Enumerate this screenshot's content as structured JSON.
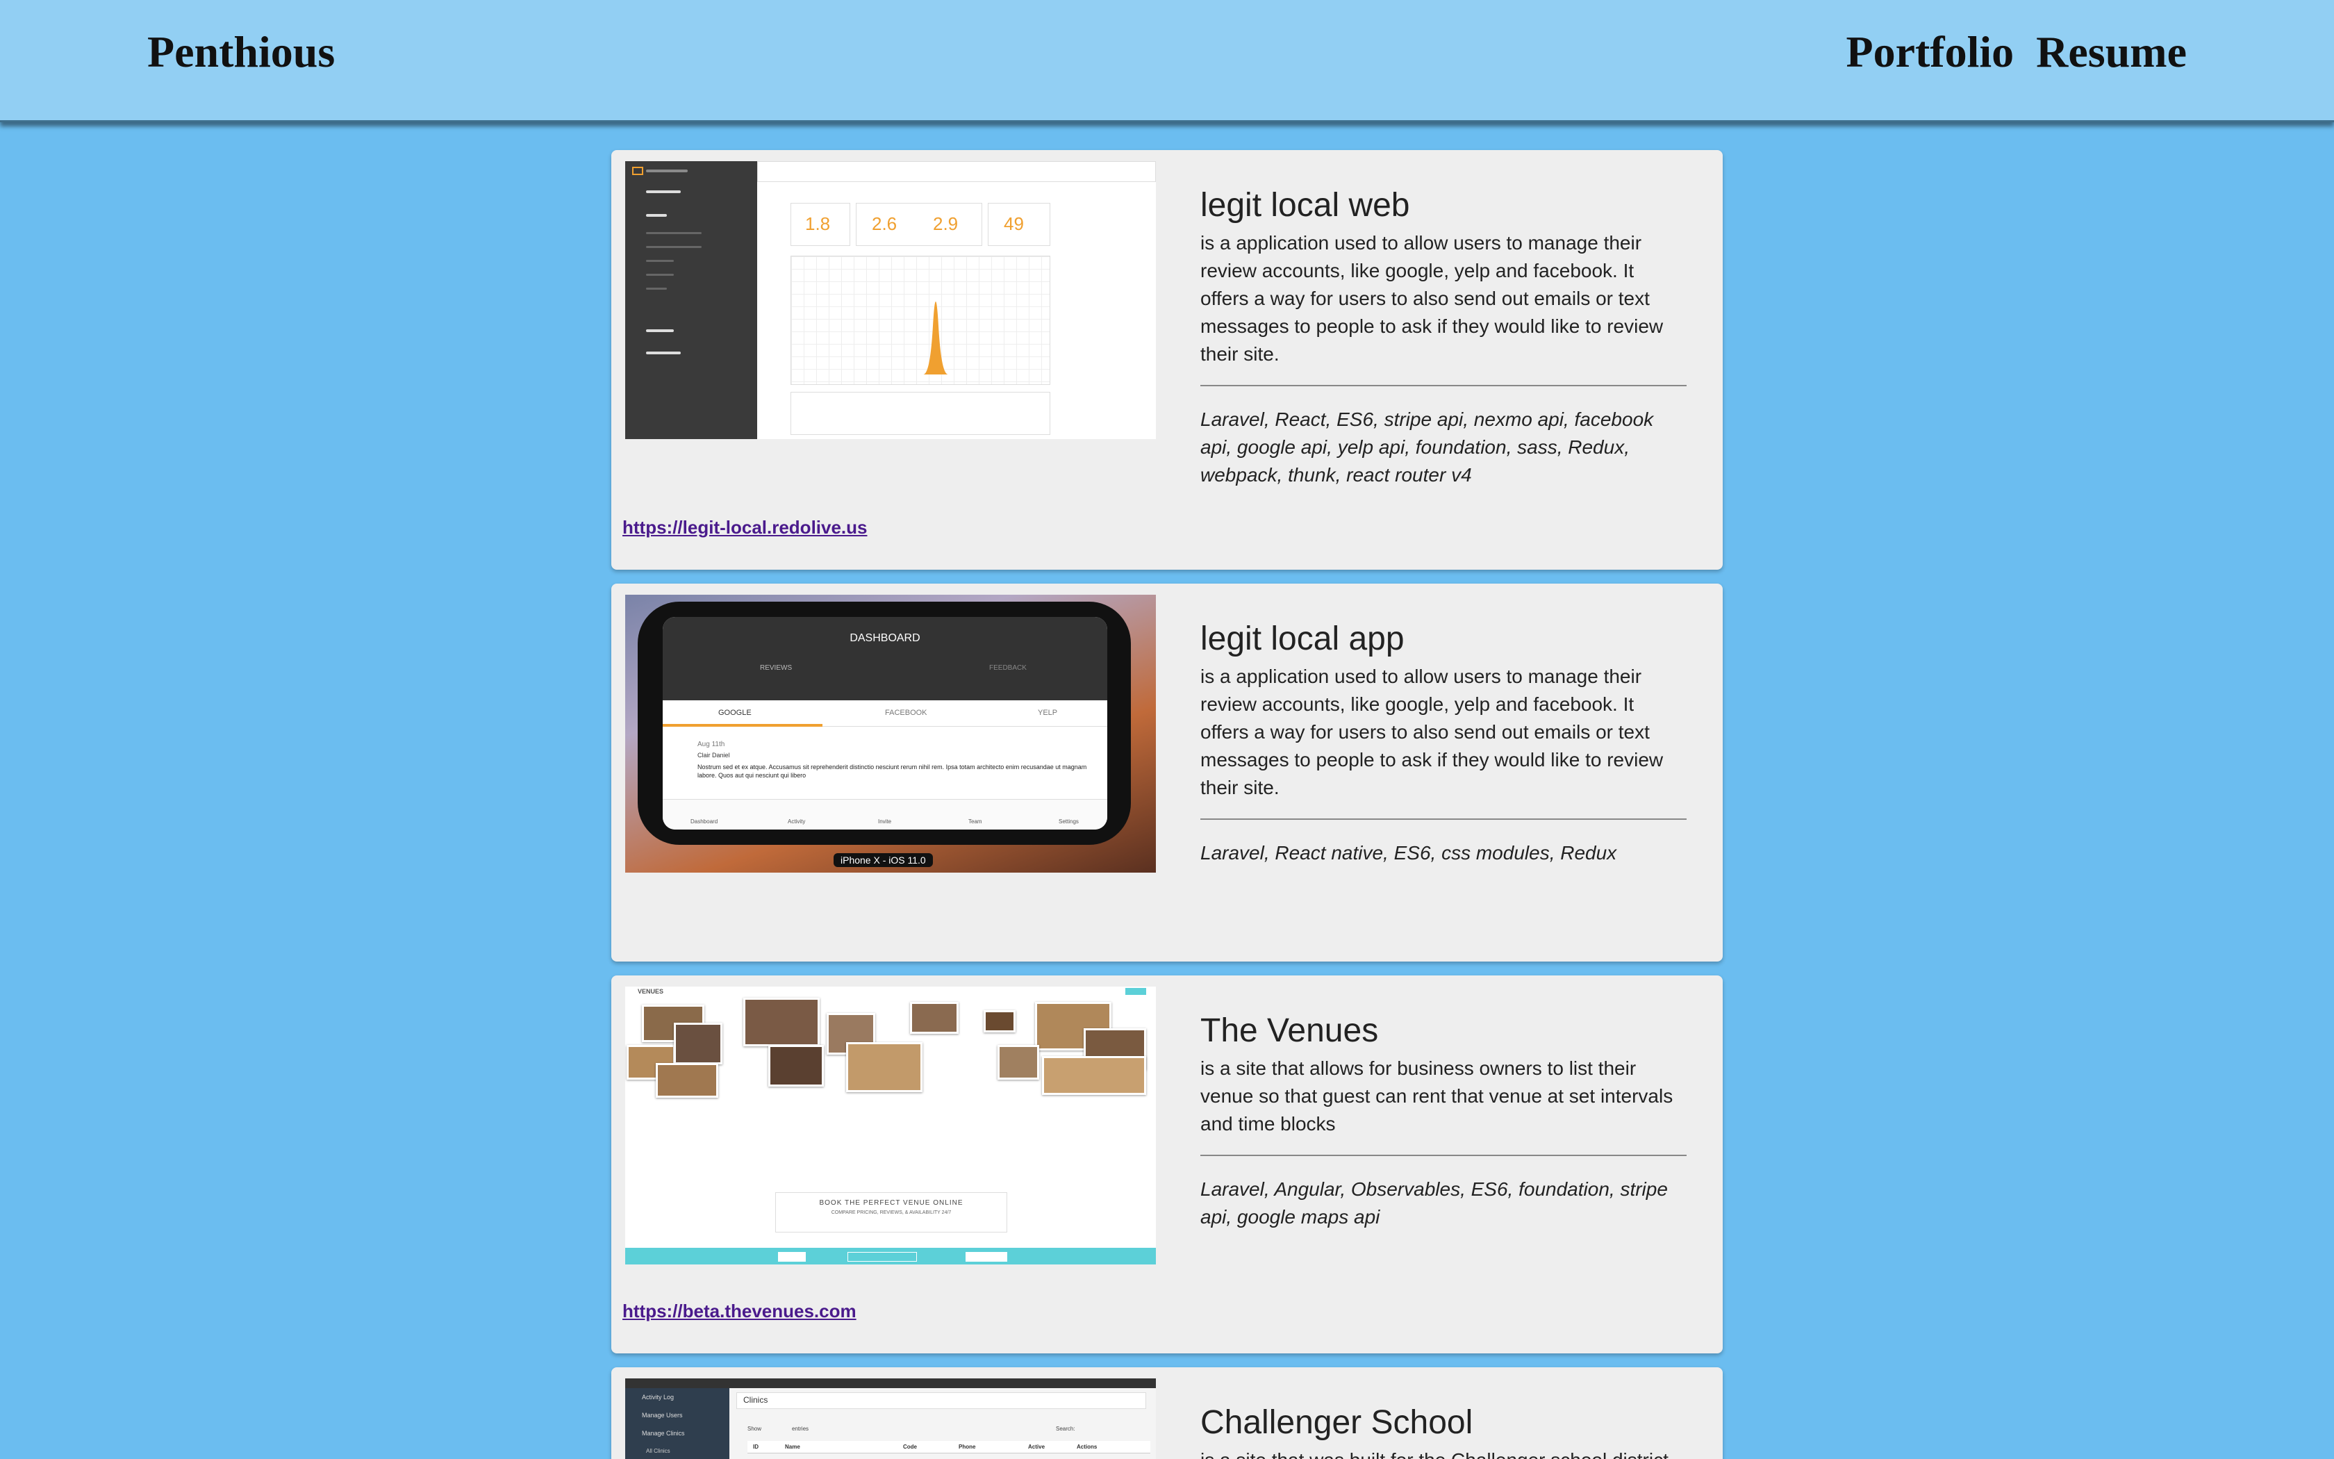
{
  "header": {
    "brand": "Penthious",
    "nav": [
      "Portfolio",
      "Resume"
    ]
  },
  "projects": [
    {
      "title": "legit local web",
      "description": "is a application used to allow users to manage their review accounts, like google, yelp and facebook. It offers a way for users to also send out emails or text messages to people to ask if they would like to review their site.",
      "tech": "Laravel, React, ES6, stripe api, nexmo api, facebook api, google api, yelp api, foundation, sass, Redux, webpack, thunk, react router v4",
      "link": "https://legit-local.redolive.us",
      "screenshot": {
        "stats": [
          "1.8",
          "2.6",
          "2.9",
          "49"
        ]
      }
    },
    {
      "title": "legit local app",
      "description": "is a application used to allow users to manage their review accounts, like google, yelp and facebook. It offers a way for users to also send out emails or text messages to people to ask if they would like to review their site.",
      "tech": "Laravel, React native, ES6, css modules, Redux",
      "link": "",
      "screenshot": {
        "header": "DASHBOARD",
        "tabs": [
          "REVIEWS",
          "FEEDBACK"
        ],
        "sources": [
          "GOOGLE",
          "FACEBOOK",
          "YELP"
        ],
        "review_date": "Aug 11th",
        "review_author": "Clair Daniel",
        "review_text": "Nostrum sed et ex atque. Accusamus sit reprehenderit distinctio nesciunt rerum nihil rem. Ipsa totam architecto enim recusandae ut magnam labore. Quos aut qui nesciunt qui libero",
        "bottom_nav": [
          "Dashboard",
          "Activity",
          "Invite",
          "Team",
          "Settings"
        ],
        "device_label": "iPhone X - iOS 11.0"
      }
    },
    {
      "title": "The Venues",
      "description": "is a site that allows for business owners to list their venue so that guest can rent that venue at set intervals and time blocks",
      "tech": "Laravel, Angular, Observables, ES6, foundation, stripe api, google maps api",
      "link": "https://beta.thevenues.com",
      "screenshot": {
        "logo": "VENUES",
        "tagline": "BOOK THE PERFECT VENUE ONLINE",
        "subline": "COMPARE PRICING, REVIEWS, & AVAILABILITY 24/7"
      }
    },
    {
      "title": "Challenger School",
      "description": "is a site that was built for the Challenger school district to",
      "tech": "",
      "link": "",
      "screenshot": {
        "menu": [
          "Activity Log",
          "Manage Users",
          "Manage Clinics",
          "All Clinics"
        ],
        "panel_title": "Clinics",
        "show_label": "Show",
        "entries_label": "entries",
        "search_label": "Search:",
        "columns": [
          "ID",
          "Name",
          "Code",
          "Phone",
          "Active",
          "Actions"
        ]
      }
    }
  ]
}
